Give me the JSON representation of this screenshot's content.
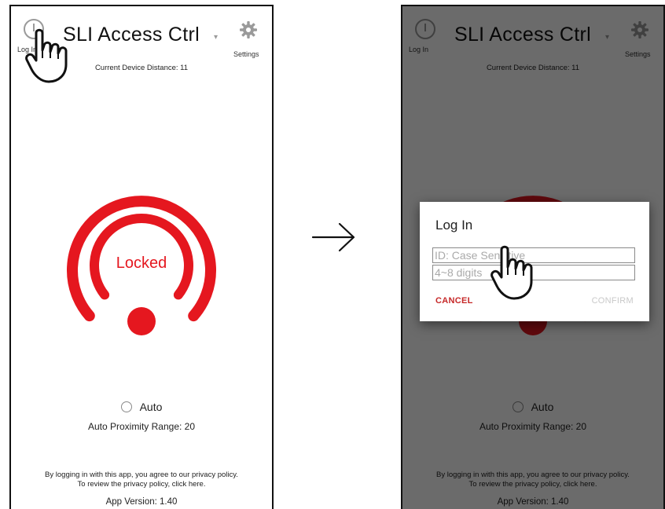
{
  "app": {
    "title": "SLI Access Ctrl",
    "login_label": "Log In",
    "settings_label": "Settings",
    "distance_text": "Current Device Distance: 11",
    "lock_status": "Locked",
    "auto_label": "Auto",
    "proximity_text": "Auto Proximity Range: 20",
    "privacy_line1": "By logging in with this app, you agree to our privacy policy.",
    "privacy_line2": "To review the privacy policy, click here.",
    "version_text": "App Version: 1.40"
  },
  "login_dialog": {
    "title": "Log In",
    "id_placeholder": "ID: Case Sensitive",
    "pin_placeholder": "4~8 digits",
    "cancel_label": "CANCEL",
    "confirm_label": "CONFIRM"
  },
  "colors": {
    "accent_red": "#e5171f",
    "cancel_red": "#c62828",
    "disabled_gray": "#c9c9c9"
  },
  "icons": [
    "login-icon",
    "gear-icon",
    "dropdown-icon",
    "arrow-right-icon",
    "pointing-hand-icon"
  ]
}
